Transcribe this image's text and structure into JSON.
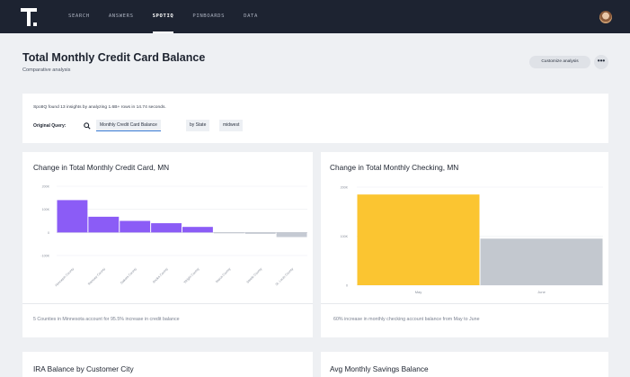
{
  "nav": {
    "items": [
      "SEARCH",
      "ANSWERS",
      "SPOTIQ",
      "PINBOARDS",
      "DATA"
    ],
    "active": "SPOTIQ"
  },
  "header": {
    "title": "Total Monthly Credit Card Balance",
    "subtitle": "Comparative analysis",
    "customize_label": "Customize analysis",
    "more_label": "•••"
  },
  "summary": {
    "text": "SpotIQ found 13 insights by analyzing 1.6B+ rows in 14.74 seconds.",
    "original_query_label": "Original Query:",
    "query_tokens": [
      "Monthly Credit Card Balance",
      "by State",
      "midwest"
    ]
  },
  "cards": [
    {
      "title": "Change in Total Monthly Credit Card, MN",
      "footer": "5 Counties in Minnesota account for 95.5% increase in credit balance"
    },
    {
      "title": "Change in Total Monthly Checking, MN",
      "footer": "60% increase in monthly checking account balance from May to June"
    },
    {
      "title": "IRA Balance by Customer City"
    },
    {
      "title": "Avg Monthly Savings Balance"
    }
  ],
  "chart_data": [
    {
      "type": "bar",
      "title": "Change in Total Monthly Credit Card, MN",
      "categories": [
        "Hennepin County",
        "Ramsey County",
        "Dakota County",
        "Anoka County",
        "Wright County",
        "Itasca County",
        "Steele County",
        "St. Louis County"
      ],
      "values": [
        140,
        68,
        50,
        40,
        24,
        -2,
        -6,
        -20
      ],
      "yticks": [
        "200K",
        "100K",
        "0",
        "-100K"
      ],
      "ylim": [
        -100,
        200
      ],
      "color": "#8b5cf6",
      "neg_color": "#c5cad3"
    },
    {
      "type": "bar",
      "title": "Change in Total Monthly Checking, MN",
      "categories": [
        "May",
        "June"
      ],
      "values": [
        185,
        95
      ],
      "yticks": [
        "200K",
        "100K",
        "0"
      ],
      "ylim": [
        0,
        200
      ],
      "colors": [
        "#fbc531",
        "#c3c8cf"
      ]
    }
  ],
  "colors": {
    "nav_bg": "#1d2331",
    "accent": "#3a7bd5",
    "page_bg": "#eef0f3"
  }
}
